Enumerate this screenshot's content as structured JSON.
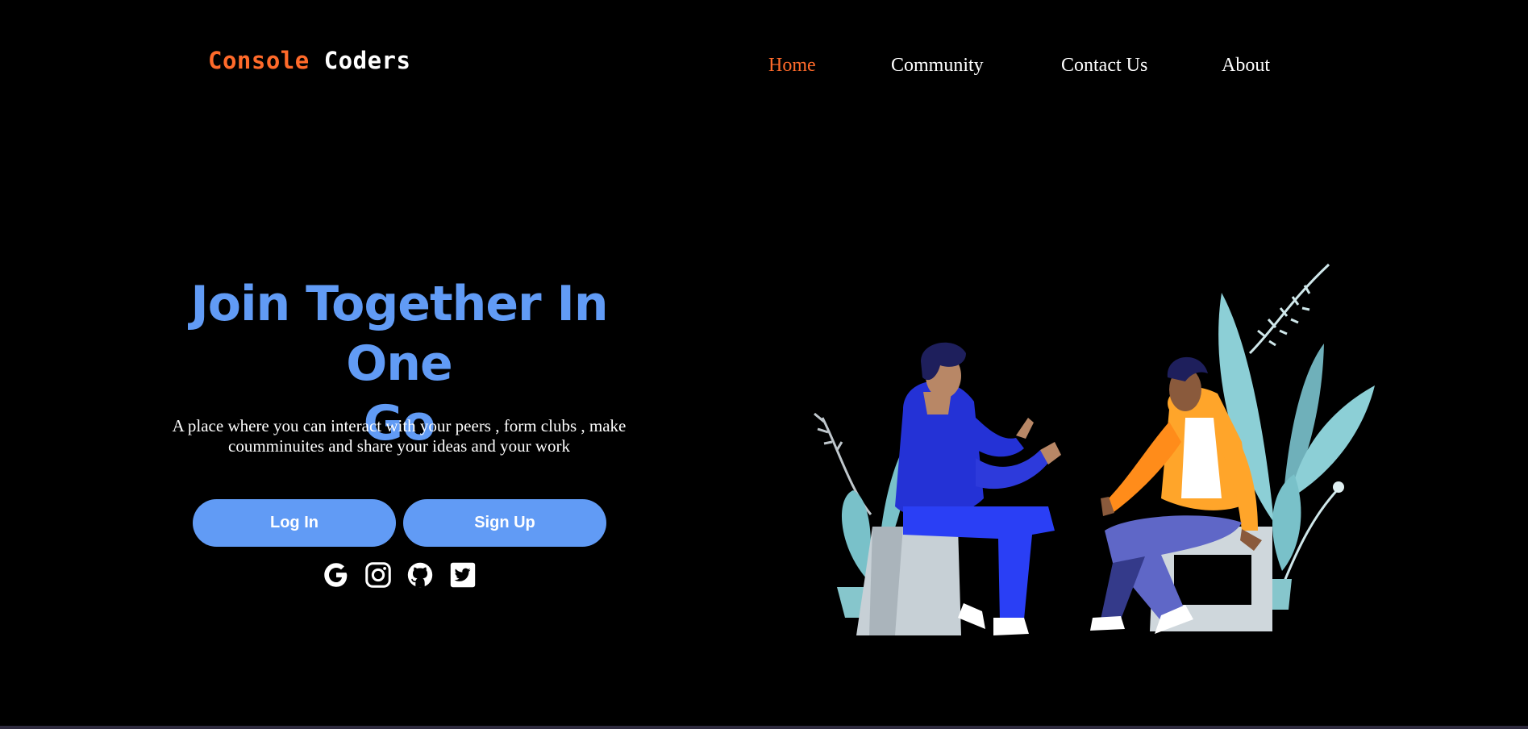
{
  "header": {
    "logo_part1": "Console",
    "logo_part2": "Coders",
    "nav": [
      {
        "label": "Home",
        "active": true
      },
      {
        "label": "Community"
      },
      {
        "label": "Contact Us"
      },
      {
        "label": "About"
      }
    ]
  },
  "hero": {
    "title_line1": "Join Together In One",
    "title_line2": "Go",
    "description_line1": "A place where you can interact with your peers , form clubs , make",
    "description_line2": "coumminuites and share your ideas and your work",
    "login_label": "Log In",
    "signup_label": "Sign Up"
  },
  "social_icons": [
    "google-icon",
    "instagram-icon",
    "github-icon",
    "twitter-icon"
  ],
  "colors": {
    "background": "#000000",
    "accent_orange": "#ff6a2a",
    "primary_blue": "#619bf5",
    "text": "#ffffff"
  }
}
